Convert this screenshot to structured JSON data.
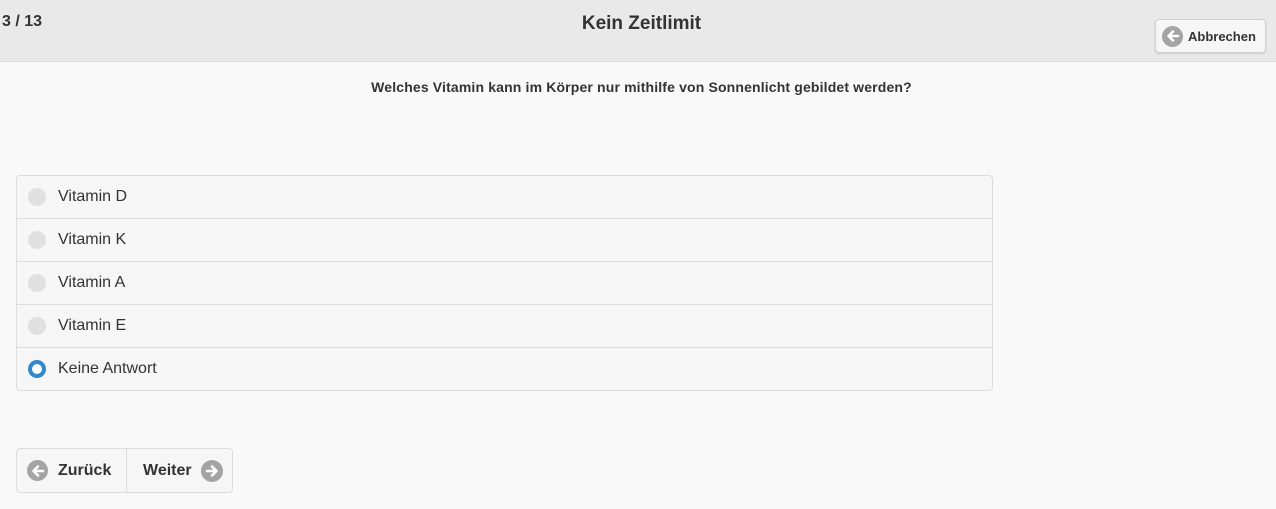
{
  "header": {
    "progress": "3 / 13",
    "title": "Kein Zeitlimit",
    "cancel_label": "Abbrechen"
  },
  "question": "Welches Vitamin kann im Körper nur mithilfe von Sonnenlicht gebildet werden?",
  "options": [
    {
      "label": "Vitamin D",
      "selected": false
    },
    {
      "label": "Vitamin K",
      "selected": false
    },
    {
      "label": "Vitamin A",
      "selected": false
    },
    {
      "label": "Vitamin E",
      "selected": false
    },
    {
      "label": "Keine Antwort",
      "selected": true
    }
  ],
  "navigation": {
    "prev_label": "Zurück",
    "next_label": "Weiter"
  },
  "colors": {
    "accent": "#3388cc",
    "icon_circle": "#a4a4a4"
  }
}
